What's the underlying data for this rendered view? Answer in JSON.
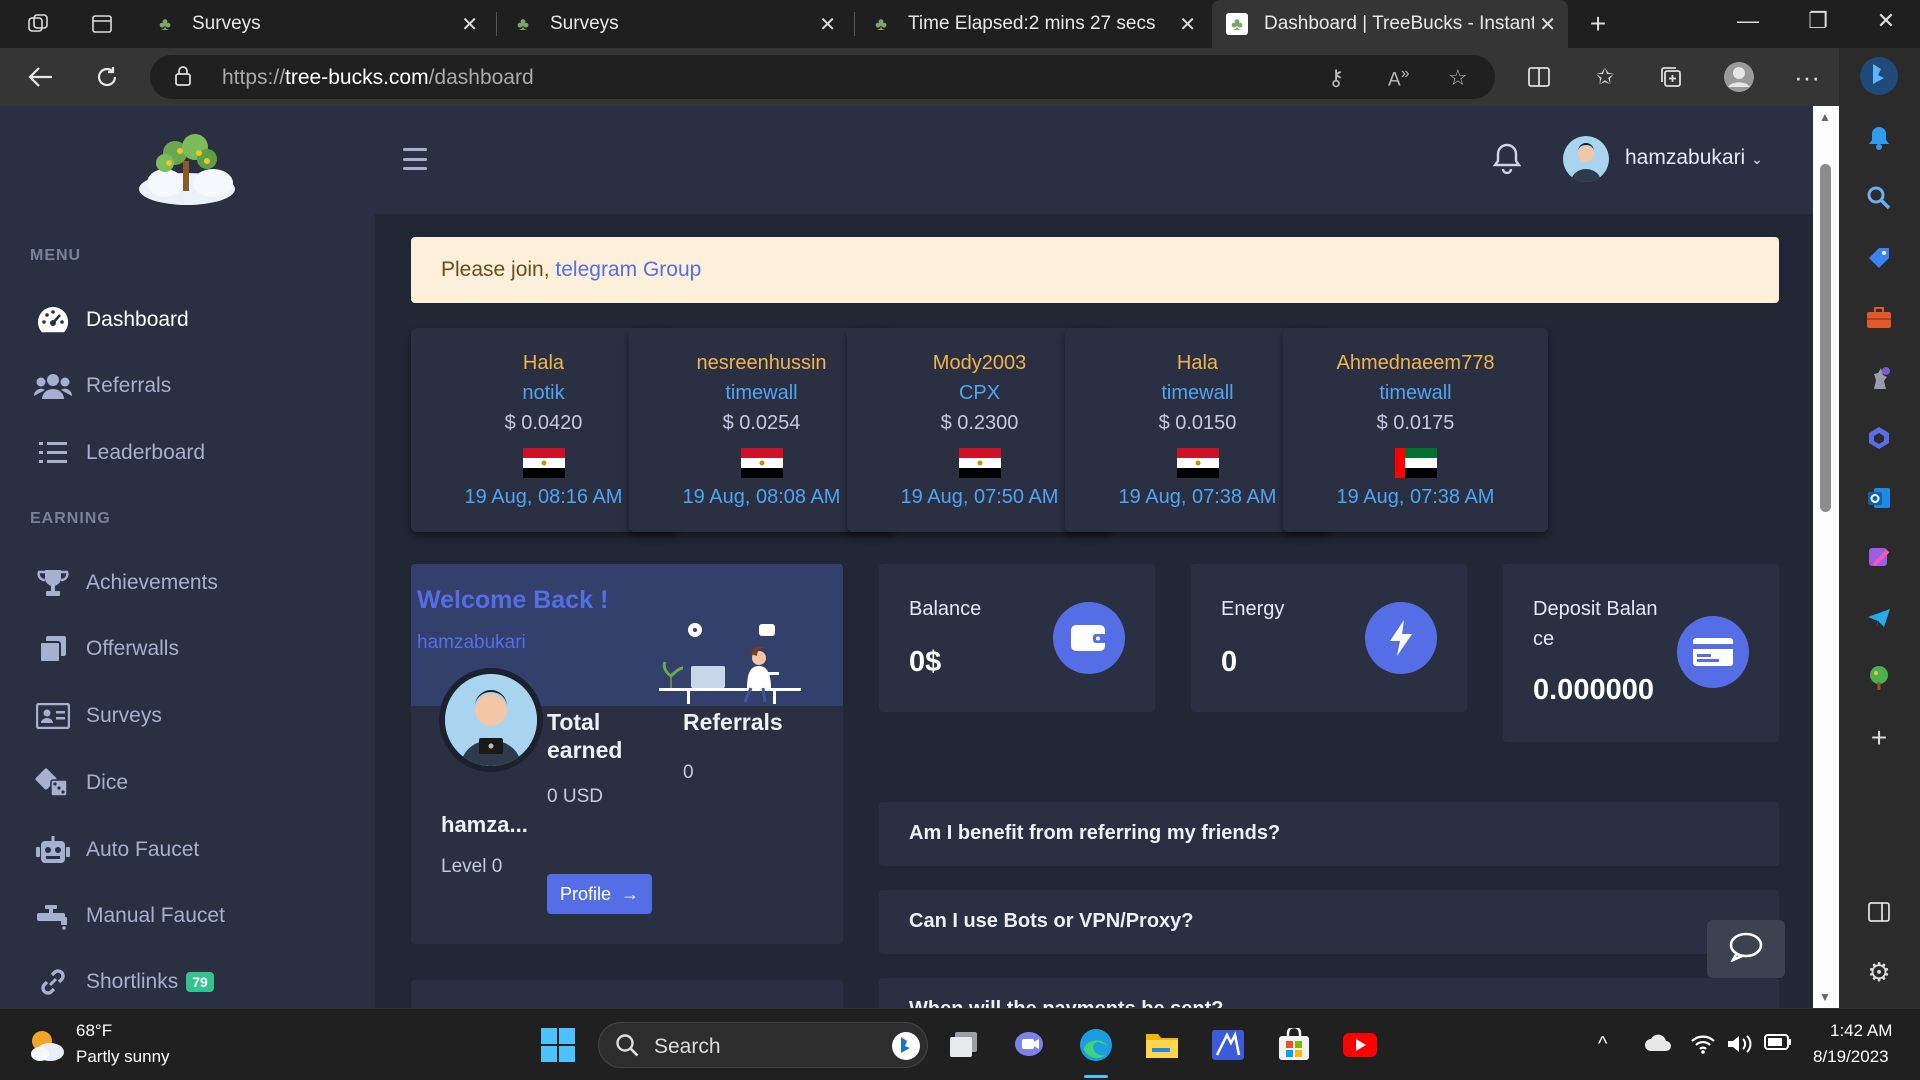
{
  "browser": {
    "tabs": [
      {
        "title": "Surveys"
      },
      {
        "title": "Surveys"
      },
      {
        "title": "Time Elapsed:2 mins 27 secs"
      },
      {
        "title": "Dashboard | TreeBucks - Instant p"
      }
    ],
    "url_prefix": "https://",
    "url_host": "tree-bucks.com",
    "url_path": "/dashboard"
  },
  "sidebar": {
    "heading_menu": "MENU",
    "heading_earning": "EARNING",
    "items": [
      {
        "label": "Dashboard",
        "icon": "speedometer-icon"
      },
      {
        "label": "Referrals",
        "icon": "users-icon"
      },
      {
        "label": "Leaderboard",
        "icon": "list-icon"
      },
      {
        "label": "Achievements",
        "icon": "trophy-icon"
      },
      {
        "label": "Offerwalls",
        "icon": "copy-icon"
      },
      {
        "label": "Surveys",
        "icon": "id-card-icon"
      },
      {
        "label": "Dice",
        "icon": "dice-icon"
      },
      {
        "label": "Auto Faucet",
        "icon": "robot-icon"
      },
      {
        "label": "Manual Faucet",
        "icon": "faucet-icon"
      },
      {
        "label": "Shortlinks",
        "icon": "link-icon",
        "badge": "79"
      }
    ]
  },
  "header": {
    "username": "hamzabukari"
  },
  "alert": {
    "text": "Please join, ",
    "link": "telegram Group"
  },
  "recent_earnings": [
    {
      "user": "Hala",
      "wall": "notik",
      "amount": "0.0420",
      "currency": "$",
      "flag": "egypt",
      "time": "19 Aug, 08:16 AM"
    },
    {
      "user": "nesreenhussin",
      "wall": "timewall",
      "amount": "0.0254",
      "currency": "$",
      "flag": "egypt",
      "time": "19 Aug, 08:08 AM"
    },
    {
      "user": "Mody2003",
      "wall": "CPX",
      "amount": "0.2300",
      "currency": "$",
      "flag": "egypt",
      "time": "19 Aug, 07:50 AM"
    },
    {
      "user": "Hala",
      "wall": "timewall",
      "amount": "0.0150",
      "currency": "$",
      "flag": "egypt",
      "time": "19 Aug, 07:38 AM"
    },
    {
      "user": "Ahmednaeem778",
      "wall": "timewall",
      "amount": "0.0175",
      "currency": "$",
      "flag": "uae",
      "time": "19 Aug, 07:38 AM"
    }
  ],
  "welcome": {
    "title": "Welcome Back !",
    "username": "hamzabukari",
    "name_truncated": "hamza...",
    "level": "Level 0",
    "total_earned_label_1": "Total",
    "total_earned_label_2": "earned",
    "total_earned_value": "0 USD",
    "referrals_label": "Referrals",
    "referrals_value": "0",
    "profile_button": "Profile"
  },
  "stats": {
    "balance_label": "Balance",
    "balance_value": "0$",
    "energy_label": "Energy",
    "energy_value": "0",
    "deposit_label_1": "Deposit Balan",
    "deposit_label_2": "ce",
    "deposit_value": "0.000000"
  },
  "faq": [
    {
      "question": "Am I benefit from referring my friends?"
    },
    {
      "question": "Can I use Bots or VPN/Proxy?"
    },
    {
      "question": "When will the payments be sent?"
    }
  ],
  "taskbar": {
    "weather_temp": "68°F",
    "weather_desc": "Partly sunny",
    "search_label": "Search",
    "time": "1:42 AM",
    "date": "8/19/2023"
  },
  "colors": {
    "sidebar_bg": "#2a3042",
    "main_bg": "#222736",
    "accent": "#556ee6",
    "user_orange": "#f1b44c",
    "link_blue": "#50a5f1",
    "badge_green": "#34c38f"
  }
}
